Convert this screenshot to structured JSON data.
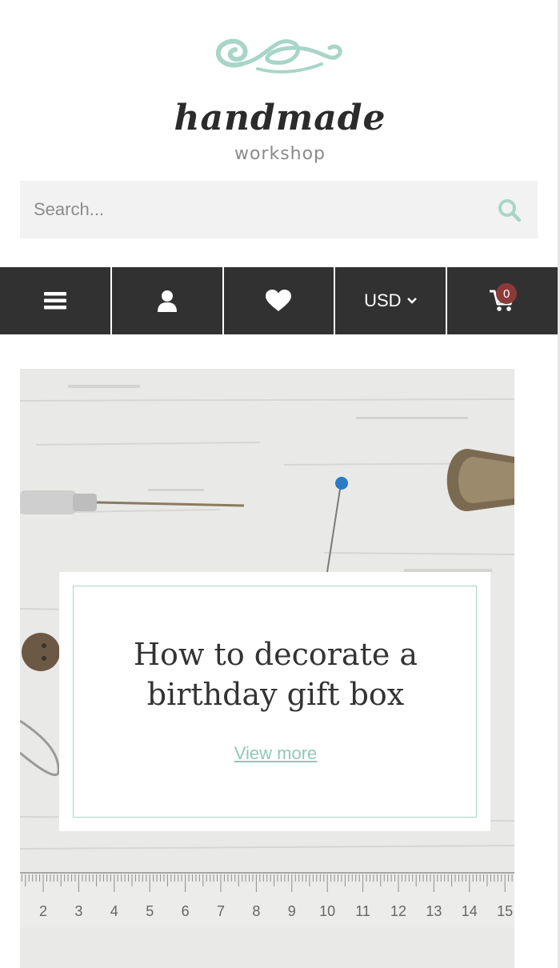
{
  "logo": {
    "wordmark": "handmade",
    "subtitle": "workshop",
    "flourish_color": "#a8d5c8"
  },
  "search": {
    "placeholder": "Search...",
    "value": "",
    "icon": "search-icon",
    "icon_color": "#a8d5c8"
  },
  "toolbar": {
    "background": "#313131",
    "menu_icon": "hamburger-menu-icon",
    "account_icon": "user-icon",
    "wishlist_icon": "heart-icon",
    "currency_label": "USD",
    "currency_icon": "chevron-down-icon",
    "cart_icon": "cart-icon",
    "cart_count": "0",
    "badge_color": "#8b3a3a"
  },
  "banner": {
    "title": "How to decorate a birthday gift box",
    "link_label": "View more",
    "accent": "#a9d3c9",
    "ruler_numbers": [
      "2",
      "3",
      "4",
      "5",
      "6",
      "7",
      "8",
      "9",
      "10",
      "11",
      "12",
      "13",
      "14",
      "15"
    ]
  }
}
